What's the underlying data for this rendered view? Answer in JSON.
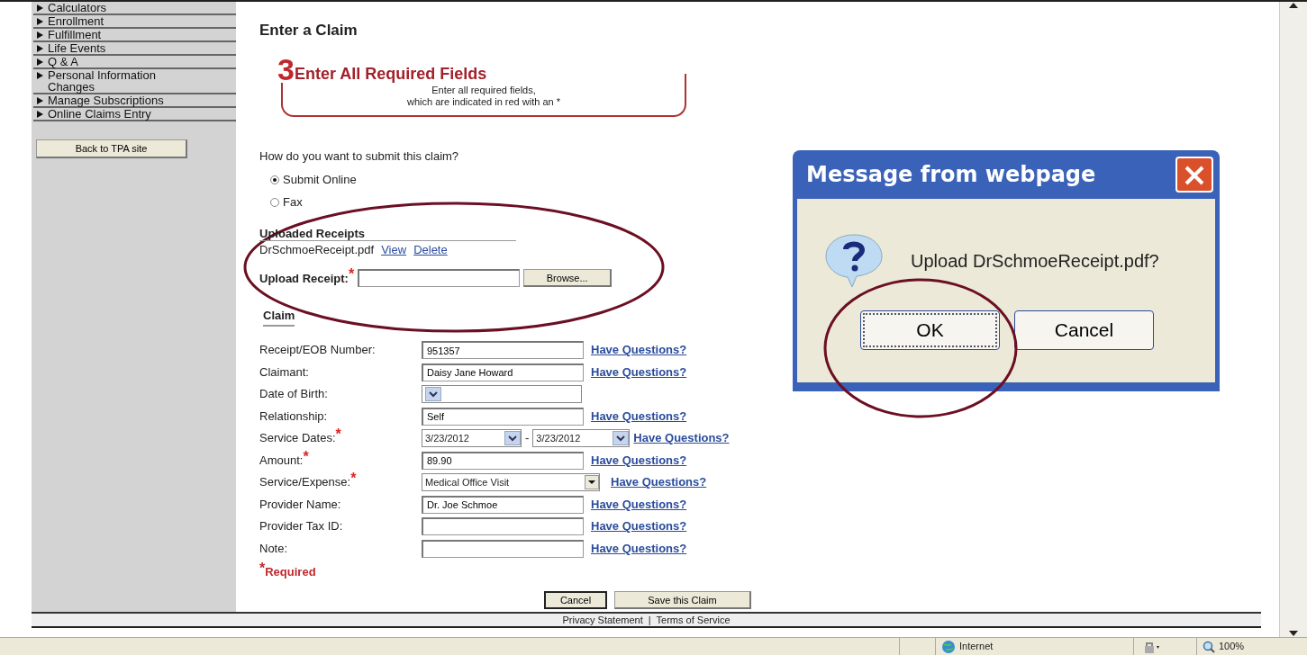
{
  "sidebar": {
    "items": [
      {
        "label": "Calculators"
      },
      {
        "label": "Enrollment"
      },
      {
        "label": "Fulfillment"
      },
      {
        "label": "Life Events"
      },
      {
        "label": "Q & A"
      },
      {
        "label": "Personal Information Changes"
      },
      {
        "label": "Manage Subscriptions"
      },
      {
        "label": "Online Claims Entry"
      }
    ],
    "back_button": "Back to TPA site"
  },
  "page_title": "Enter a Claim",
  "step_banner": {
    "number": "3",
    "title": "Enter All Required Fields",
    "lines": [
      "Enter all required fields,",
      "which are indicated in red with an *"
    ]
  },
  "submit_method": {
    "question": "How do you want to submit this claim?",
    "options": [
      {
        "label": "Submit Online",
        "selected": true
      },
      {
        "label": "Fax",
        "selected": false
      }
    ]
  },
  "uploaded_receipts": {
    "heading": "Uploaded Receipts",
    "files": [
      {
        "name": "DrSchmoeReceipt.pdf",
        "actions": [
          "View",
          "Delete"
        ]
      }
    ]
  },
  "upload": {
    "label": "Upload Receipt:",
    "required": true,
    "browse": "Browse..."
  },
  "claim_heading": "Claim",
  "fields": [
    {
      "kind": "text",
      "label": "Receipt/EOB Number:",
      "required": false,
      "value": "951357",
      "help": "Have Questions?"
    },
    {
      "kind": "text",
      "label": "Claimant:",
      "required": false,
      "value": "Daisy Jane Howard",
      "help": "Have Questions?"
    },
    {
      "kind": "date",
      "label": "Date of Birth:",
      "required": false
    },
    {
      "kind": "text",
      "label": "Relationship:",
      "required": false,
      "value": "Self",
      "help": "Have Questions?"
    },
    {
      "kind": "daterange",
      "label": "Service Dates:",
      "required": true,
      "from": "3/23/2012",
      "separator": "-",
      "to": "3/23/2012",
      "help": "Have Questions?"
    },
    {
      "kind": "text",
      "label": "Amount:",
      "required": true,
      "value": "89.90",
      "help": "Have Questions?"
    },
    {
      "kind": "dropdown",
      "label": "Service/Expense:",
      "required": true,
      "value": "Medical Office Visit",
      "help": "Have Questions?"
    },
    {
      "kind": "text",
      "label": "Provider Name:",
      "required": false,
      "value": "Dr. Joe Schmoe",
      "help": "Have Questions?"
    },
    {
      "kind": "text",
      "label": "Provider Tax ID:",
      "required": false,
      "help": "Have Questions?"
    },
    {
      "kind": "text",
      "label": "Note:",
      "required": false,
      "help": "Have Questions?"
    }
  ],
  "required_note": {
    "mark": "*",
    "text": "Required"
  },
  "buttons": [
    "Cancel",
    "Save this Claim"
  ],
  "footer": {
    "links": [
      "Privacy Statement",
      "Terms of Service"
    ],
    "separator": "|"
  },
  "dialog": {
    "title": "Message from webpage",
    "message": "Upload DrSchmoeReceipt.pdf?",
    "buttons": [
      {
        "label": "OK",
        "focused": true
      },
      {
        "label": "Cancel",
        "focused": false
      }
    ]
  },
  "status_bar": {
    "zone": "Internet",
    "zoom": "100%"
  }
}
